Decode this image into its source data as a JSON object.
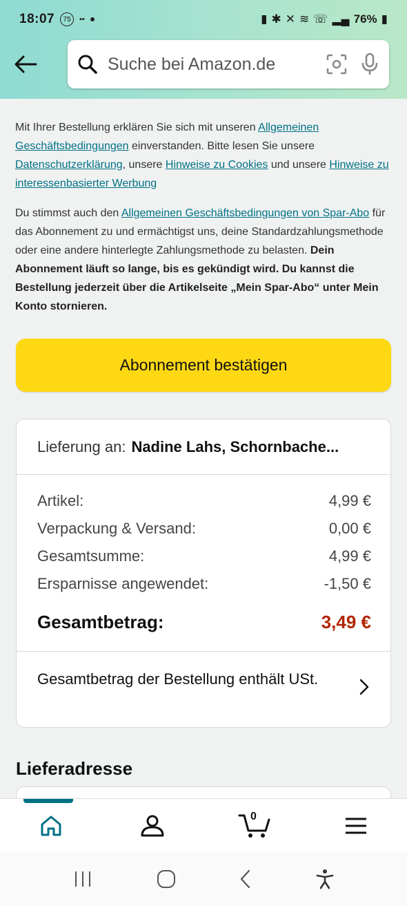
{
  "status_bar": {
    "time": "18:07",
    "badge": "75",
    "battery": "76%"
  },
  "search": {
    "placeholder": "Suche bei Amazon.de"
  },
  "legal": {
    "p1_a": "Mit Ihrer Bestellung erklären Sie sich mit unseren ",
    "p1_link1": "Allgemeinen Geschäftsbedingungen",
    "p1_b": " einverstanden. Bitte lesen Sie unsere ",
    "p1_link2": "Datenschutzerklärung",
    "p1_c": ", unsere ",
    "p1_link3": "Hinweise zu Cookies",
    "p1_d": " und unsere ",
    "p1_link4": "Hinweise zu interessenbasierter Werbung",
    "p2_a": "Du stimmst auch den ",
    "p2_link1": "Allgemeinen Geschäftsbedingungen von Spar-Abo",
    "p2_b": " für das Abonnement zu und ermächtigst uns, deine Standardzahlungsmethode oder eine andere hinterlegte Zahlungsmethode zu belasten. ",
    "p2_bold": "Dein Abonnement läuft so lange, bis es gekündigt wird. Du kannst die Bestellung jederzeit über die Artikelseite „Mein Spar-Abo“ unter Mein Konto stornieren."
  },
  "confirm_button": "Abonnement bestätigen",
  "summary": {
    "delivery_label": "Lieferung an:",
    "delivery_name": "Nadine Lahs, Schornbache...",
    "rows": [
      {
        "label": "Artikel:",
        "value": "4,99 €"
      },
      {
        "label": "Verpackung & Versand:",
        "value": "0,00 €"
      },
      {
        "label": "Gesamtsumme:",
        "value": "4,99 €"
      },
      {
        "label": "Ersparnisse angewendet:",
        "value": "-1,50 €"
      }
    ],
    "total_label": "Gesamtbetrag:",
    "total_value": "3,49 €",
    "vat_text": "Gesamtbetrag der Bestellung enthält USt."
  },
  "section_heading": "Lieferadresse",
  "bottom_nav": {
    "cart_count": "0"
  },
  "colors": {
    "accent": "#007185",
    "button": "#ffd814",
    "price": "#b12704"
  }
}
